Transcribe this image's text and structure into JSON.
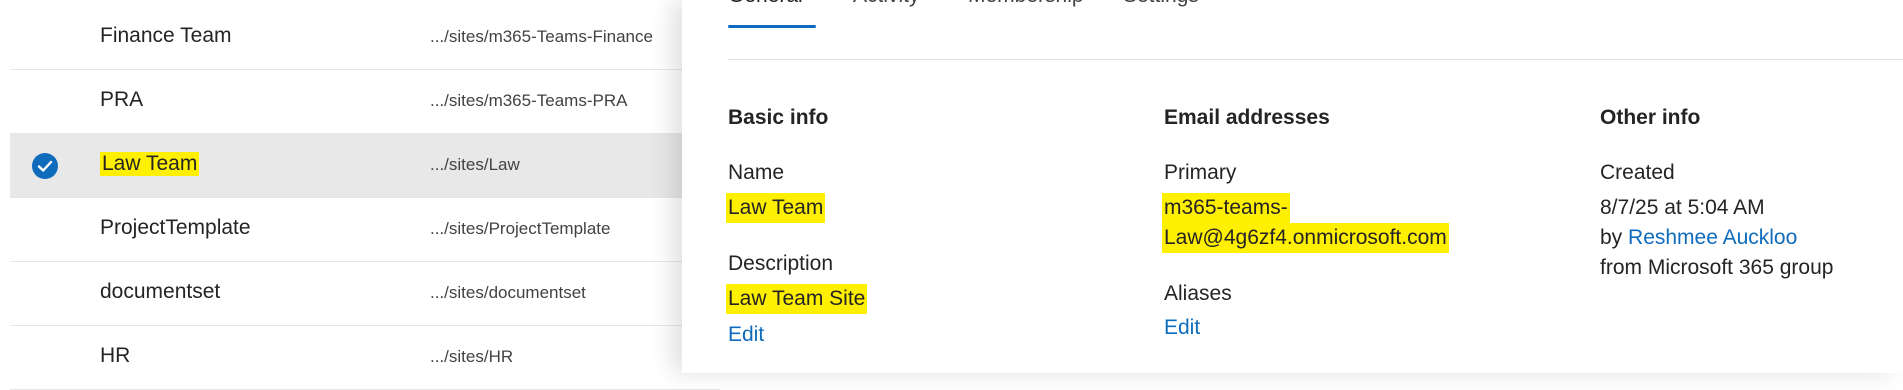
{
  "list": {
    "rows": [
      {
        "name": "Finance Team",
        "url": ".../sites/m365-Teams-Finance"
      },
      {
        "name": "PRA",
        "url": ".../sites/m365-Teams-PRA"
      },
      {
        "name": "Law Team",
        "url": ".../sites/Law"
      },
      {
        "name": "ProjectTemplate",
        "url": ".../sites/ProjectTemplate"
      },
      {
        "name": "documentset",
        "url": ".../sites/documentset"
      },
      {
        "name": "HR",
        "url": ".../sites/HR"
      }
    ]
  },
  "panel": {
    "tabs": [
      "General",
      "Activity",
      "Membership",
      "Settings"
    ],
    "basic_info": {
      "title": "Basic info",
      "name_label": "Name",
      "name_value": "Law Team",
      "description_label": "Description",
      "description_value": "Law Team Site",
      "edit_label": "Edit"
    },
    "email": {
      "title": "Email addresses",
      "primary_label": "Primary",
      "primary_line1": "m365-teams-",
      "primary_line2": "Law@4g6zf4.onmicrosoft.com",
      "aliases_label": "Aliases",
      "edit_label": "Edit"
    },
    "other": {
      "title": "Other info",
      "created_label": "Created",
      "created_value": "8/7/25 at 5:04 AM",
      "by_prefix": "by",
      "by_user": "Reshmee Auckloo",
      "from_text": "from Microsoft 365 group"
    }
  },
  "colors": {
    "accent": "#0f6cbd",
    "highlight": "#ffef00",
    "selected_row": "#e8e8e8"
  }
}
